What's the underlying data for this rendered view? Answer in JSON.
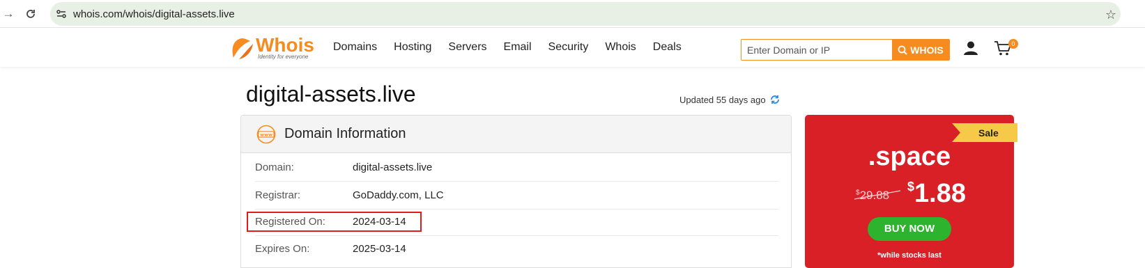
{
  "browser": {
    "url": "whois.com/whois/digital-assets.live"
  },
  "header": {
    "logo_text": "Whois",
    "logo_tagline": "Identity for everyone",
    "nav": [
      "Domains",
      "Hosting",
      "Servers",
      "Email",
      "Security",
      "Whois",
      "Deals"
    ],
    "search_placeholder": "Enter Domain or IP",
    "search_button": "WHOIS",
    "cart_count": "0"
  },
  "page": {
    "title": "digital-assets.live",
    "updated": "Updated 55 days ago"
  },
  "domain_info": {
    "heading": "Domain Information",
    "rows": [
      {
        "label": "Domain:",
        "value": "digital-assets.live"
      },
      {
        "label": "Registrar:",
        "value": "GoDaddy.com, LLC"
      },
      {
        "label": "Registered On:",
        "value": "2024-03-14"
      },
      {
        "label": "Expires On:",
        "value": "2025-03-14"
      }
    ]
  },
  "promo": {
    "badge": "Sale",
    "tld": ".space",
    "old_price_symbol": "$",
    "old_price": "29.88",
    "new_price_symbol": "$",
    "new_price": "1.88",
    "button": "BUY NOW",
    "note": "*while stocks last"
  },
  "colors": {
    "accent": "#f68b1f",
    "promo_bg": "#d92027",
    "buy_button": "#2db32d",
    "highlight": "#e01b1b"
  }
}
